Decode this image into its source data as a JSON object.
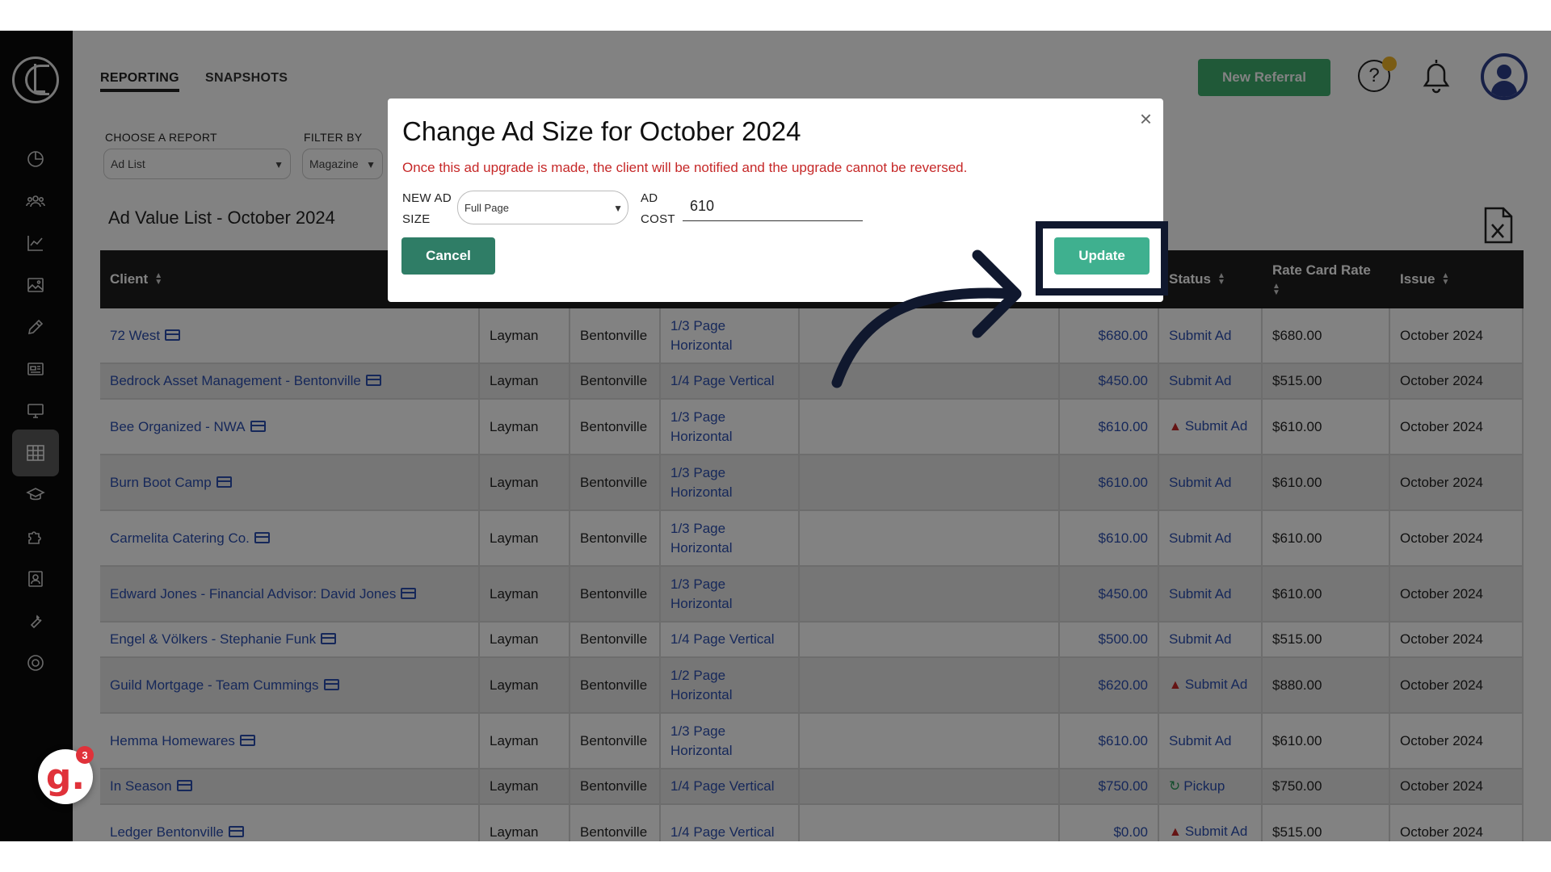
{
  "nav": {
    "tabs": [
      "REPORTING",
      "SNAPSHOTS"
    ],
    "new_referral_label": "New Referral",
    "help_symbol": "?",
    "sidebar_icons": [
      "dashboard-icon",
      "people-icon",
      "analytics-icon",
      "image-icon",
      "pencil-icon",
      "newspaper-icon",
      "monitor-icon",
      "grid-icon",
      "graduation-cap-icon",
      "puzzle-icon",
      "contacts-icon",
      "wrench-icon",
      "support-icon"
    ],
    "active_sidebar_icon": "grid-icon"
  },
  "filters": {
    "report_label": "CHOOSE A REPORT",
    "report_value": "Ad List",
    "filter_label": "FILTER BY",
    "filter_value": "Magazine"
  },
  "list": {
    "title": "Ad Value List - October 2024",
    "headers": {
      "client": "Client",
      "status": "Status",
      "rate_card": "Rate Card Rate",
      "issue": "Issue"
    },
    "rows": [
      {
        "client": "72 West",
        "magazine": "Layman",
        "city": "Bentonville",
        "size": "1/3 Page Horizontal",
        "value": "$680.00",
        "status": "Submit Ad",
        "status_icon": "",
        "rate": "$680.00",
        "issue": "October 2024"
      },
      {
        "client": "Bedrock Asset Management - Bentonville",
        "magazine": "Layman",
        "city": "Bentonville",
        "size": "1/4 Page Vertical",
        "value": "$450.00",
        "status": "Submit Ad",
        "status_icon": "",
        "rate": "$515.00",
        "issue": "October 2024"
      },
      {
        "client": "Bee Organized - NWA",
        "magazine": "Layman",
        "city": "Bentonville",
        "size": "1/3 Page Horizontal",
        "value": "$610.00",
        "status": "Submit Ad",
        "status_icon": "warning",
        "rate": "$610.00",
        "issue": "October 2024"
      },
      {
        "client": "Burn Boot Camp",
        "magazine": "Layman",
        "city": "Bentonville",
        "size": "1/3 Page Horizontal",
        "value": "$610.00",
        "status": "Submit Ad",
        "status_icon": "",
        "rate": "$610.00",
        "issue": "October 2024"
      },
      {
        "client": "Carmelita Catering Co.",
        "magazine": "Layman",
        "city": "Bentonville",
        "size": "1/3 Page Horizontal",
        "value": "$610.00",
        "status": "Submit Ad",
        "status_icon": "",
        "rate": "$610.00",
        "issue": "October 2024"
      },
      {
        "client": "Edward Jones - Financial Advisor: David Jones",
        "magazine": "Layman",
        "city": "Bentonville",
        "size": "1/3 Page Horizontal",
        "value": "$450.00",
        "status": "Submit Ad",
        "status_icon": "",
        "rate": "$610.00",
        "issue": "October 2024"
      },
      {
        "client": "Engel & Völkers - Stephanie Funk",
        "magazine": "Layman",
        "city": "Bentonville",
        "size": "1/4 Page Vertical",
        "value": "$500.00",
        "status": "Submit Ad",
        "status_icon": "",
        "rate": "$515.00",
        "issue": "October 2024"
      },
      {
        "client": "Guild Mortgage - Team Cummings",
        "magazine": "Layman",
        "city": "Bentonville",
        "size": "1/2 Page Horizontal",
        "value": "$620.00",
        "status": "Submit Ad",
        "status_icon": "warning",
        "rate": "$880.00",
        "issue": "October 2024"
      },
      {
        "client": "Hemma Homewares",
        "magazine": "Layman",
        "city": "Bentonville",
        "size": "1/3 Page Horizontal",
        "value": "$610.00",
        "status": "Submit Ad",
        "status_icon": "",
        "rate": "$610.00",
        "issue": "October 2024"
      },
      {
        "client": "In Season",
        "magazine": "Layman",
        "city": "Bentonville",
        "size": "1/4 Page Vertical",
        "value": "$750.00",
        "status": "Pickup",
        "status_icon": "refresh",
        "rate": "$750.00",
        "issue": "October 2024"
      },
      {
        "client": "Ledger Bentonville",
        "magazine": "Layman",
        "city": "Bentonville",
        "size": "1/4 Page Vertical",
        "value": "$0.00",
        "status": "Submit Ad",
        "status_icon": "warning",
        "rate": "$515.00",
        "issue": "October 2024"
      }
    ]
  },
  "dialog": {
    "title": "Change Ad Size for October 2024",
    "warning": "Once this ad upgrade is made, the client will be notified and the upgrade cannot be reversed.",
    "size_label_1": "NEW AD",
    "size_label_2": "SIZE",
    "size_value": "Full Page",
    "cost_label_1": "AD",
    "cost_label_2": "COST",
    "cost_value": "610",
    "cancel_label": "Cancel",
    "update_label": "Update",
    "close_symbol": "×"
  },
  "helper": {
    "badge_letter": "g.",
    "badge_count": "3"
  },
  "colors": {
    "accent_green": "#3fae6f",
    "link_blue": "#2c4fb0",
    "warning_red": "#c62828",
    "annotation_navy": "#10182e"
  }
}
